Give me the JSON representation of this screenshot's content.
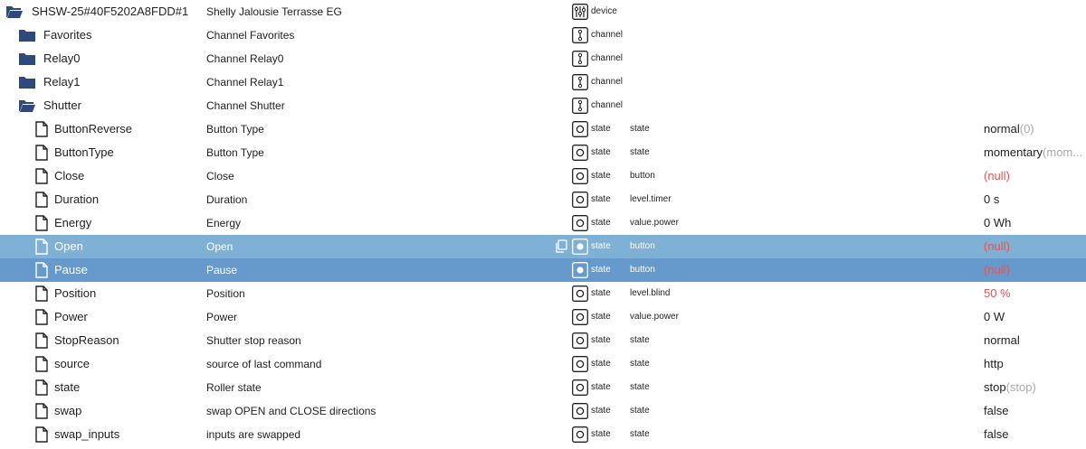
{
  "tree": {
    "rows": [
      {
        "name": "SHSW-25#40F5202A8FDD#1",
        "desc": "Shelly Jalousie Terrasse EG",
        "type": "device",
        "role": "",
        "value": "",
        "unit": "",
        "kind": "folder-open",
        "level": 0,
        "typeIcon": "device-icon",
        "state": "normal",
        "nullValue": false
      },
      {
        "name": "Favorites",
        "desc": "Channel Favorites",
        "type": "channel",
        "role": "",
        "value": "",
        "unit": "",
        "kind": "folder",
        "level": 1,
        "typeIcon": "channel-icon",
        "state": "normal",
        "nullValue": false
      },
      {
        "name": "Relay0",
        "desc": "Channel Relay0",
        "type": "channel",
        "role": "",
        "value": "",
        "unit": "",
        "kind": "folder",
        "level": 1,
        "typeIcon": "channel-icon",
        "state": "normal",
        "nullValue": false
      },
      {
        "name": "Relay1",
        "desc": "Channel Relay1",
        "type": "channel",
        "role": "",
        "value": "",
        "unit": "",
        "kind": "folder",
        "level": 1,
        "typeIcon": "channel-icon",
        "state": "normal",
        "nullValue": false
      },
      {
        "name": "Shutter",
        "desc": "Channel Shutter",
        "type": "channel",
        "role": "",
        "value": "",
        "unit": "",
        "kind": "folder-open",
        "level": 1,
        "typeIcon": "channel-icon",
        "state": "normal",
        "nullValue": false
      },
      {
        "name": "ButtonReverse",
        "desc": "Button Type",
        "type": "state",
        "role": "state",
        "value": "normal",
        "unit": "(0)",
        "kind": "file",
        "level": 2,
        "typeIcon": "state-icon",
        "state": "normal",
        "nullValue": false
      },
      {
        "name": "ButtonType",
        "desc": "Button Type",
        "type": "state",
        "role": "state",
        "value": "momentary",
        "unit": "(mom...",
        "kind": "file",
        "level": 2,
        "typeIcon": "state-icon",
        "state": "normal",
        "nullValue": false
      },
      {
        "name": "Close",
        "desc": "Close",
        "type": "state",
        "role": "button",
        "value": "(null)",
        "unit": "",
        "kind": "file",
        "level": 2,
        "typeIcon": "state-icon",
        "state": "normal",
        "nullValue": true
      },
      {
        "name": "Duration",
        "desc": "Duration",
        "type": "state",
        "role": "level.timer",
        "value": "0 s",
        "unit": "",
        "kind": "file",
        "level": 2,
        "typeIcon": "state-icon",
        "state": "normal",
        "nullValue": false
      },
      {
        "name": "Energy",
        "desc": "Energy",
        "type": "state",
        "role": "value.power",
        "value": "0 Wh",
        "unit": "",
        "kind": "file",
        "level": 2,
        "typeIcon": "state-icon",
        "state": "normal",
        "nullValue": false
      },
      {
        "name": "Open",
        "desc": "Open",
        "type": "state",
        "role": "button",
        "value": "(null)",
        "unit": "",
        "kind": "file",
        "level": 2,
        "typeIcon": "state-icon",
        "state": "hover",
        "nullValue": true
      },
      {
        "name": "Pause",
        "desc": "Pause",
        "type": "state",
        "role": "button",
        "value": "(null)",
        "unit": "",
        "kind": "file",
        "level": 2,
        "typeIcon": "state-icon",
        "state": "selected",
        "nullValue": true
      },
      {
        "name": "Position",
        "desc": "Position",
        "type": "state",
        "role": "level.blind",
        "value": "50 %",
        "unit": "",
        "kind": "file",
        "level": 2,
        "typeIcon": "state-icon",
        "state": "normal",
        "nullValue": true
      },
      {
        "name": "Power",
        "desc": "Power",
        "type": "state",
        "role": "value.power",
        "value": "0 W",
        "unit": "",
        "kind": "file",
        "level": 2,
        "typeIcon": "state-icon",
        "state": "normal",
        "nullValue": false
      },
      {
        "name": "StopReason",
        "desc": "Shutter stop reason",
        "type": "state",
        "role": "state",
        "value": "normal",
        "unit": "",
        "kind": "file",
        "level": 2,
        "typeIcon": "state-icon",
        "state": "normal",
        "nullValue": false
      },
      {
        "name": "source",
        "desc": "source of last command",
        "type": "state",
        "role": "state",
        "value": "http",
        "unit": "",
        "kind": "file",
        "level": 2,
        "typeIcon": "state-icon",
        "state": "normal",
        "nullValue": false
      },
      {
        "name": "state",
        "desc": "Roller state",
        "type": "state",
        "role": "state",
        "value": "stop",
        "unit": "(stop)",
        "kind": "file",
        "level": 2,
        "typeIcon": "state-icon",
        "state": "normal",
        "nullValue": false
      },
      {
        "name": "swap",
        "desc": "swap OPEN and CLOSE directions",
        "type": "state",
        "role": "state",
        "value": "false",
        "unit": "",
        "kind": "file",
        "level": 2,
        "typeIcon": "state-icon",
        "state": "normal",
        "nullValue": false
      },
      {
        "name": "swap_inputs",
        "desc": "inputs are swapped",
        "type": "state",
        "role": "state",
        "value": "false",
        "unit": "",
        "kind": "file",
        "level": 2,
        "typeIcon": "state-icon",
        "state": "normal",
        "nullValue": false
      }
    ]
  },
  "colors": {
    "folder": "#2c4a7c",
    "hover_row": "#7fb0d6",
    "selected_row": "#6699cc",
    "null_value": "#e05555"
  },
  "copyIcon": "copy-icon"
}
